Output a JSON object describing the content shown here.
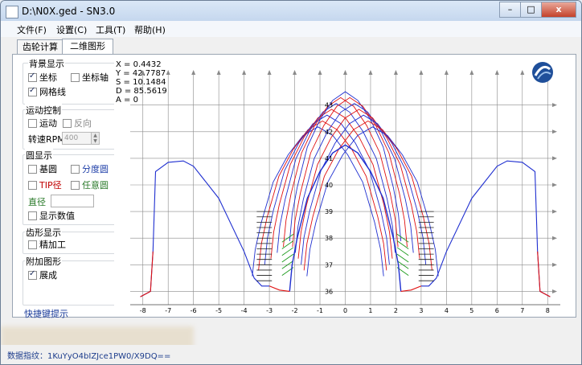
{
  "window": {
    "title": "D:\\N0X.ged - SN3.0",
    "buttons": {
      "minimize": "–",
      "maximize": "□",
      "close": "x"
    }
  },
  "menu": [
    "文件(F)",
    "设置(C)",
    "工具(T)",
    "帮助(H)"
  ],
  "tabs": [
    "齿轮计算",
    "二维图形"
  ],
  "panel": {
    "background_display": {
      "title": "背景显示",
      "coord_label": "坐标",
      "coord_checked": true,
      "axis_label": "坐标轴",
      "axis_checked": false,
      "grid_label": "网格线",
      "grid_checked": true
    },
    "motion": {
      "title": "运动控制",
      "move_label": "运动",
      "move_checked": false,
      "reverse_label": "反向",
      "reverse_checked": false,
      "speed_label": "转速RPM",
      "speed_value": "400"
    },
    "circles": {
      "title": "圆显示",
      "base_label": "基圆",
      "base_checked": false,
      "pitch_label": "分度圆",
      "pitch_checked": false,
      "tip_label": "TIP径",
      "tip_checked": false,
      "any_label": "任意圆",
      "any_checked": false,
      "diameter_label": "直径",
      "diameter_value": "",
      "show_value_label": "显示数值",
      "show_value_checked": false
    },
    "tooth": {
      "title": "齿形显示",
      "finish_label": "精加工",
      "finish_checked": false
    },
    "extra": {
      "title": "附加图形",
      "gen_label": "展成",
      "gen_checked": true
    },
    "shortcut_link": "快捷键提示"
  },
  "readout": {
    "x": "X = 0.4432",
    "y": "Y = 42.7787",
    "s": "S = 10.1484",
    "d": "D = 85.5619",
    "a": "A = 0"
  },
  "chart_data": {
    "type": "line",
    "x_ticks": [
      "-8",
      "-7",
      "-6",
      "-5",
      "-4",
      "-3",
      "-2",
      "-1",
      "0",
      "1",
      "2",
      "3",
      "4",
      "5",
      "6",
      "7",
      "8"
    ],
    "y_ticks": [
      "36",
      "37",
      "38",
      "39",
      "40",
      "41",
      "42",
      "43"
    ],
    "xlim": [
      -8.5,
      8.5
    ],
    "ylim": [
      35.5,
      44.5
    ],
    "grid": true,
    "colors": {
      "profile": "#1f2fd0",
      "generating": "#e01010",
      "green": "#1b9a1b",
      "cutter": "#1a1a1a",
      "grid": "#8a8a8a"
    },
    "center_tooth_profile": [
      [
        -2.2,
        36.0
      ],
      [
        -2.1,
        37.0
      ],
      [
        -1.9,
        38.0
      ],
      [
        -1.5,
        39.5
      ],
      [
        -1.0,
        40.5
      ],
      [
        -0.5,
        41.2
      ],
      [
        0,
        41.5
      ],
      [
        0.5,
        41.2
      ],
      [
        1.0,
        40.5
      ],
      [
        1.5,
        39.5
      ],
      [
        1.9,
        38.0
      ],
      [
        2.1,
        37.0
      ],
      [
        2.2,
        36.0
      ]
    ],
    "left_tooth_profile": [
      [
        -8.1,
        35.8
      ],
      [
        -7.7,
        36.0
      ],
      [
        -7.6,
        37.5
      ],
      [
        -7.5,
        40.5
      ],
      [
        -7.0,
        40.85
      ],
      [
        -6.4,
        40.9
      ],
      [
        -6.0,
        40.7
      ],
      [
        -5.0,
        39.5
      ],
      [
        -4.0,
        37.5
      ],
      [
        -3.6,
        36.5
      ],
      [
        -3.3,
        36.2
      ],
      [
        -3.0,
        36.2
      ]
    ],
    "right_tooth_profile": [
      [
        3.0,
        36.2
      ],
      [
        3.3,
        36.2
      ],
      [
        3.6,
        36.5
      ],
      [
        4.0,
        37.5
      ],
      [
        5.0,
        39.5
      ],
      [
        6.0,
        40.7
      ],
      [
        6.4,
        40.9
      ],
      [
        7.0,
        40.85
      ],
      [
        7.5,
        40.5
      ],
      [
        7.6,
        37.5
      ],
      [
        7.7,
        36.0
      ],
      [
        8.1,
        35.8
      ]
    ]
  },
  "status": {
    "text": "数据指纹：1KuYyO4bIZJce1PW0/X9DQ=="
  }
}
